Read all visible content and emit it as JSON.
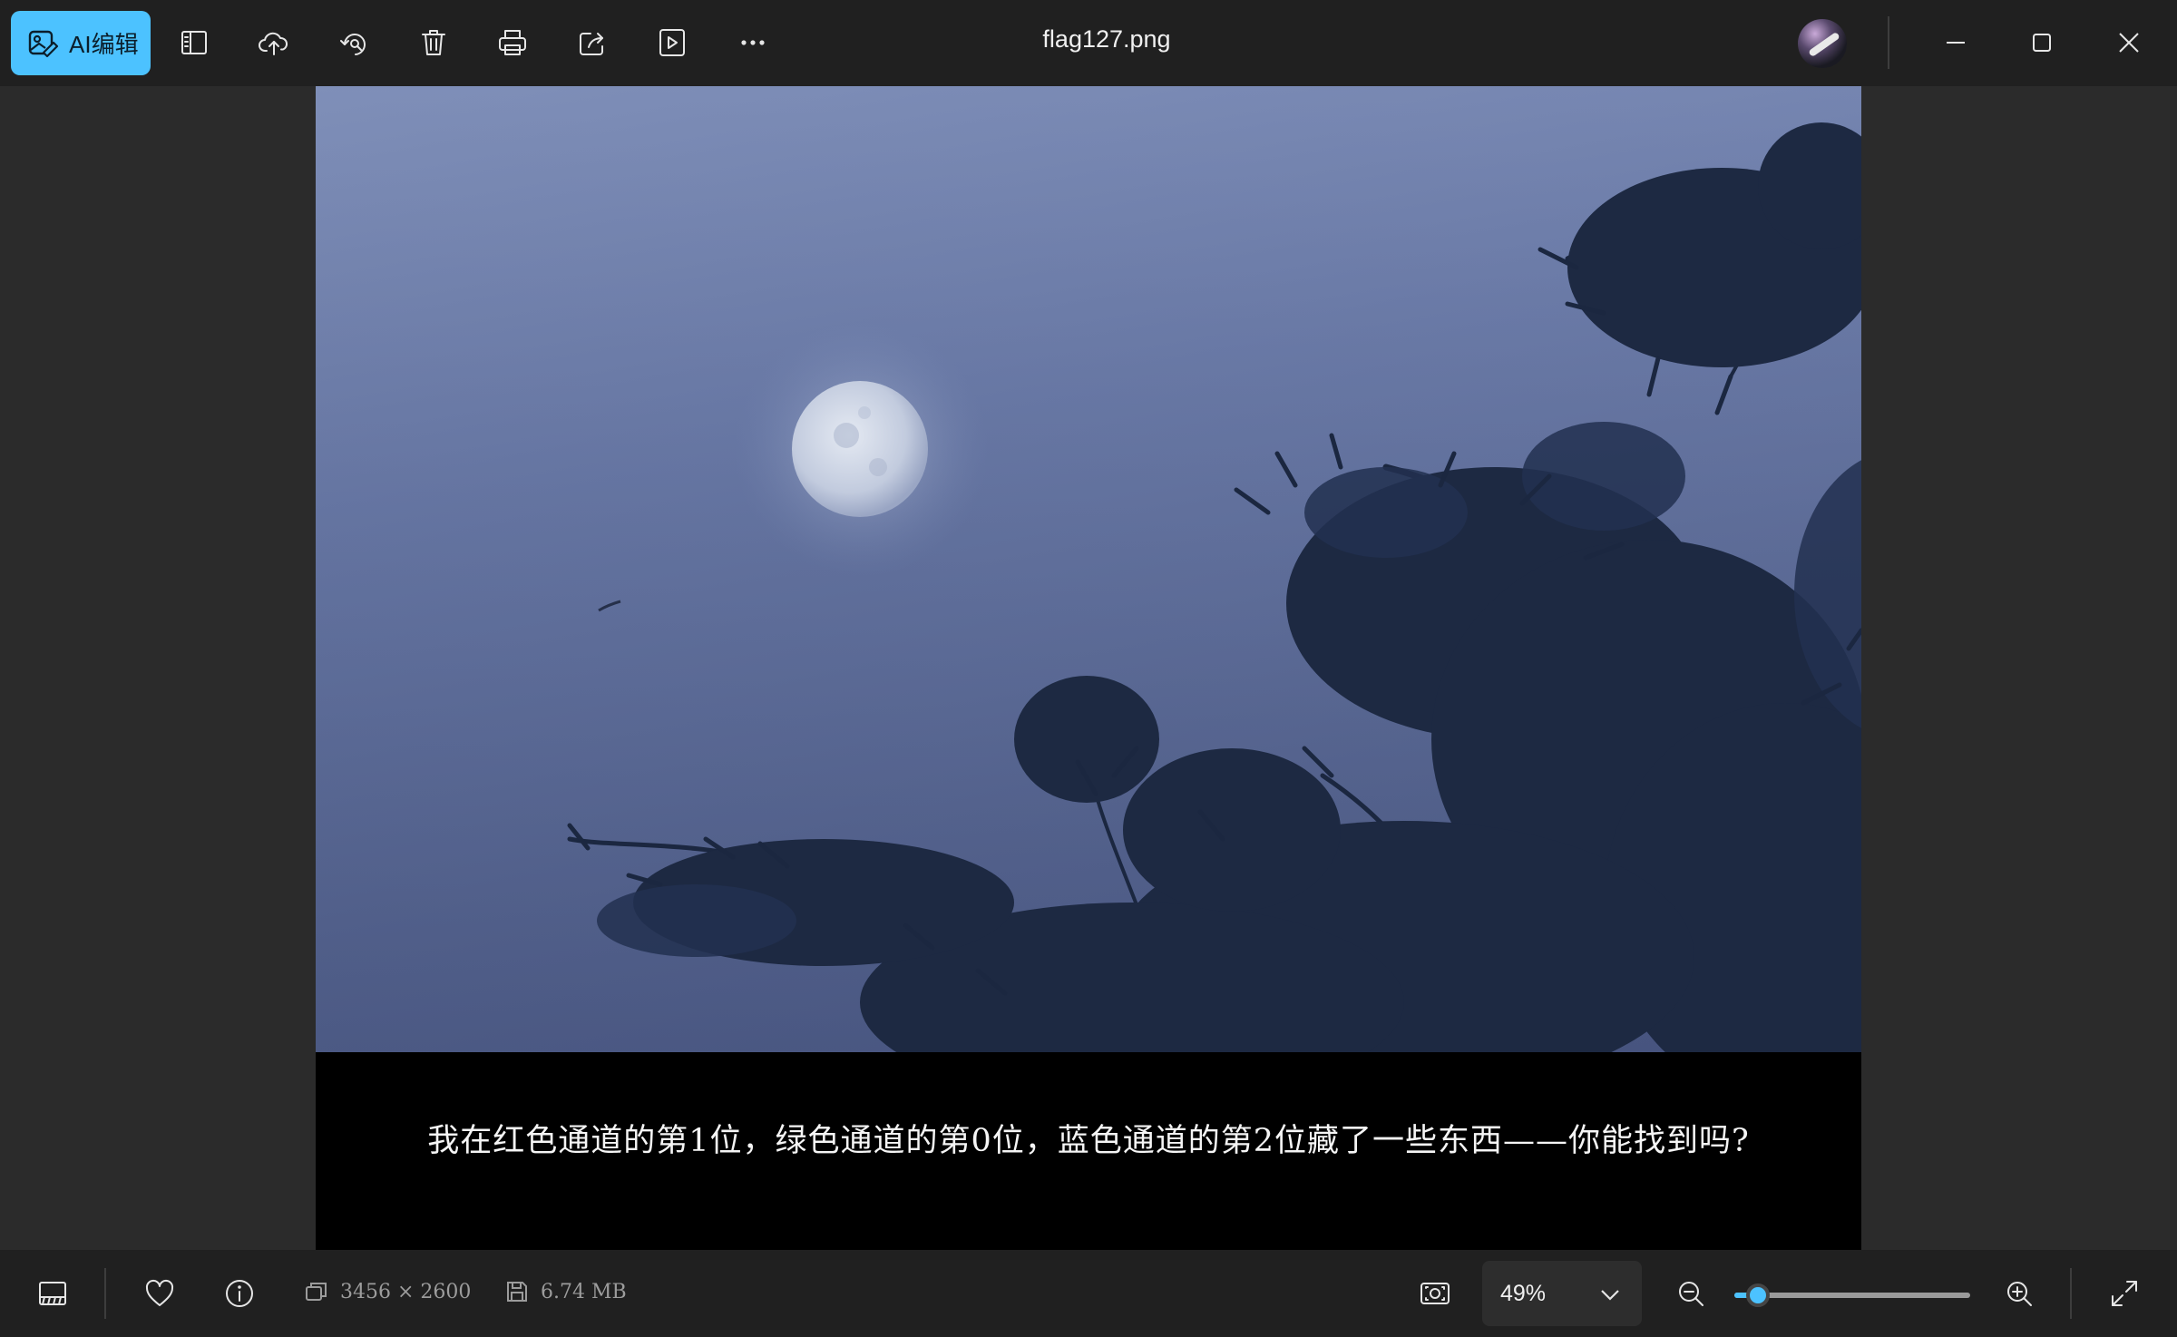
{
  "toolbar": {
    "ai_edit_label": "AI编辑",
    "icons": [
      "sidebar-icon",
      "upload-cloud-icon",
      "rotate-search-icon",
      "trash-icon",
      "print-icon",
      "share-icon",
      "slideshow-icon",
      "more-icon"
    ]
  },
  "window": {
    "title": "flag127.png"
  },
  "image": {
    "caption": "我在红色通道的第1位，绿色通道的第0位，蓝色通道的第2位藏了一些东西——你能找到吗?"
  },
  "status": {
    "dimensions": "3456 × 2600",
    "file_size": "6.74 MB",
    "zoom": "49%",
    "zoom_fraction": 0.1
  },
  "colors": {
    "accent": "#4cc2ff",
    "toolbar_bg": "#202020",
    "canvas_bg": "#2b2b2b"
  }
}
